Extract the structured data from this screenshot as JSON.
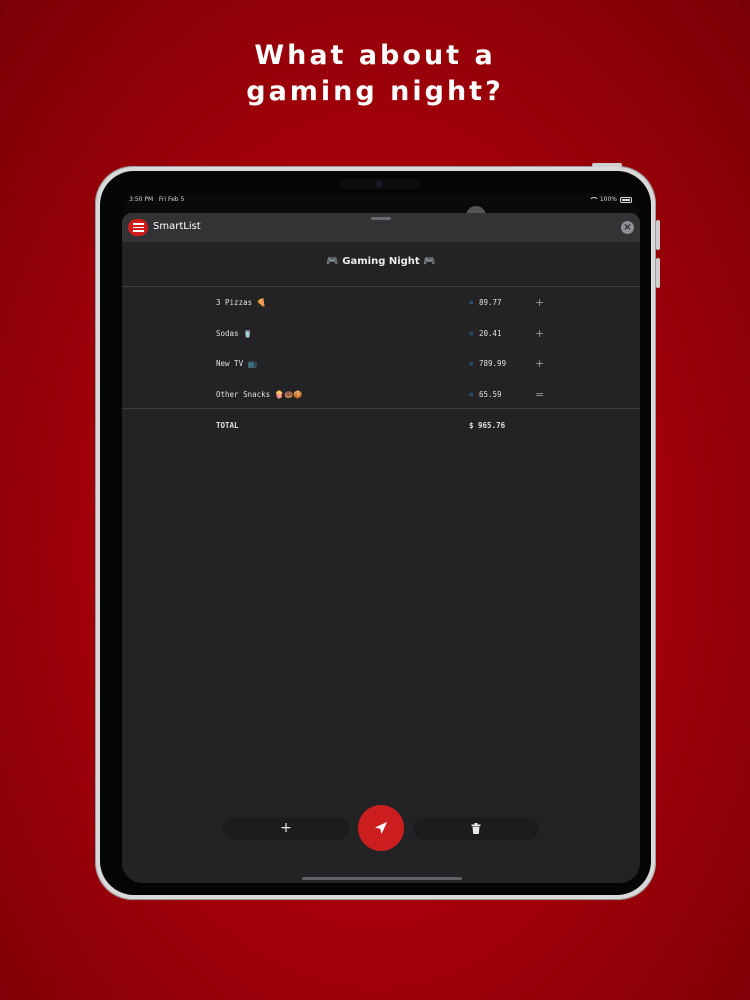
{
  "headline": {
    "line1": "What about a",
    "line2": "gaming night?"
  },
  "statusbar": {
    "time": "3:50 PM",
    "date": "Fri Feb 5",
    "battery": "100%"
  },
  "app": {
    "title": "SmartList",
    "close_icon": "×"
  },
  "list": {
    "title": "🎮 Gaming Night 🎮",
    "items": [
      {
        "name": "3 Pizzas 🍕",
        "eq": "=",
        "value": "89.77",
        "op": "+"
      },
      {
        "name": "Sodas 🥤",
        "eq": "=",
        "value": "20.41",
        "op": "+"
      },
      {
        "name": "New TV 📺",
        "eq": "=",
        "value": "789.99",
        "op": "+"
      },
      {
        "name": "Other Snacks 🍿🍩🍪",
        "eq": "=",
        "value": "65.59",
        "op": "="
      }
    ],
    "total": {
      "label": "TOTAL",
      "value": "$ 965.76"
    }
  },
  "toolbar": {
    "add_label": "+",
    "trash_icon": "trash-icon",
    "send_icon": "send-icon"
  },
  "colors": {
    "accent": "#cc1e1e",
    "background": "#b0000a",
    "sheet": "#232325",
    "equals": "#3b80d6"
  }
}
